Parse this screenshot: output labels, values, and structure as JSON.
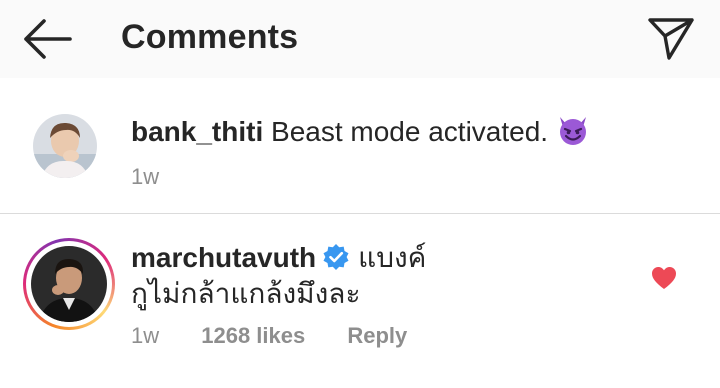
{
  "header": {
    "title": "Comments",
    "back_icon": "arrow-left-icon",
    "send_icon": "paper-plane-icon"
  },
  "caption": {
    "username": "bank_thiti",
    "text": "Beast mode activated.",
    "emoji": "smiling-devil-emoji",
    "time": "1w"
  },
  "comments": [
    {
      "username": "marchutavuth",
      "verified": true,
      "mention": "แบงค์",
      "text": "กูไม่กล้าแกล้งมึงละ",
      "time": "1w",
      "likes": "1268 likes",
      "reply_label": "Reply",
      "liked": true
    }
  ],
  "colors": {
    "heart": "#ed4956",
    "verified": "#3897f0",
    "secondary_text": "#8e8e8e",
    "primary_text": "#262626",
    "header_bg": "#fafafa",
    "divider": "#dbdbdb"
  }
}
